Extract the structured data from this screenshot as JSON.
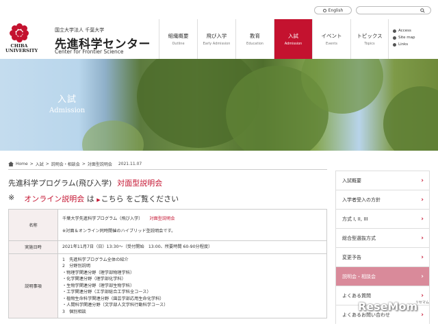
{
  "header": {
    "logo_line1": "CHIBA",
    "logo_line2": "UNIVERSITY",
    "org": "国立大学法人 千葉大学",
    "title": "先進科学センター",
    "subtitle": "Center for Frontier Science",
    "english_label": "English",
    "search_icon": "search-icon"
  },
  "nav": [
    {
      "jp": "組織概要",
      "en": "Outline",
      "active": false
    },
    {
      "jp": "飛び入学",
      "en": "Early Admission",
      "active": false
    },
    {
      "jp": "教育",
      "en": "Education",
      "active": false
    },
    {
      "jp": "入試",
      "en": "Admission",
      "active": true
    },
    {
      "jp": "イベント",
      "en": "Events",
      "active": false
    },
    {
      "jp": "トピックス",
      "en": "Topics",
      "active": false
    }
  ],
  "util_links": [
    "Access",
    "Site map",
    "Links"
  ],
  "hero": {
    "jp": "入試",
    "en": "Admission"
  },
  "breadcrumb": [
    "Home",
    "入試",
    "説明会・相談会",
    "対面型説明会",
    "2021.11.07"
  ],
  "content": {
    "heading": "先進科学プログラム(飛び入学)",
    "heading_red": "対面型説明会",
    "notice_mark": "※",
    "notice_red": "オンライン説明会",
    "notice_mid": "は",
    "notice_link": "こちら",
    "notice_end": "をご覧ください"
  },
  "table": {
    "row1_label": "名称",
    "row1_line1": "千葉大学先進科学プログラム（飛び入学）",
    "row1_line1_red": "対面型説明会",
    "row1_line2": "※対面＆オンライン同時開催のハイブリッド型説明会です。",
    "row2_label": "実施日時",
    "row2_value": "2021年11月7日（日）13:30～（受付開始　13:00、所要時間 60-90分程度）",
    "row3_label": "説明事項",
    "row3_lines": [
      "1　先進科学プログラム全体の紹介",
      "2　分野別説明",
      "・物理学関連分野（理学部物理学科）",
      "・化学関連分野（理学部化学科）",
      "・生物学関連分野（理学部生物学科）",
      "・工学関連分野（工学部総合工学科全コース）",
      "・植物生命科学関連分野（園芸学部応用生命化学科）",
      "・人間科学関連分野（文学部人文学科行動科学コース）",
      "3　個別相談"
    ]
  },
  "sidebar": [
    {
      "label": "入試概要",
      "active": false
    },
    {
      "label": "入学者受入の方針",
      "active": false
    },
    {
      "label": "方式 I, II, III",
      "active": false
    },
    {
      "label": "総合型選抜方式",
      "active": false
    },
    {
      "label": "変更予告",
      "active": false
    },
    {
      "label": "説明会・相談会",
      "active": true
    },
    {
      "label": "よくある質問",
      "active": false
    },
    {
      "label": "よくあるお問い合わせ",
      "active": false
    }
  ],
  "watermark": {
    "text": "ReseMom",
    "sub": "リセマム"
  },
  "colors": {
    "accent": "#c4122f",
    "sidebar_active": "#d98a9a",
    "label_bg": "#f5eeee"
  }
}
